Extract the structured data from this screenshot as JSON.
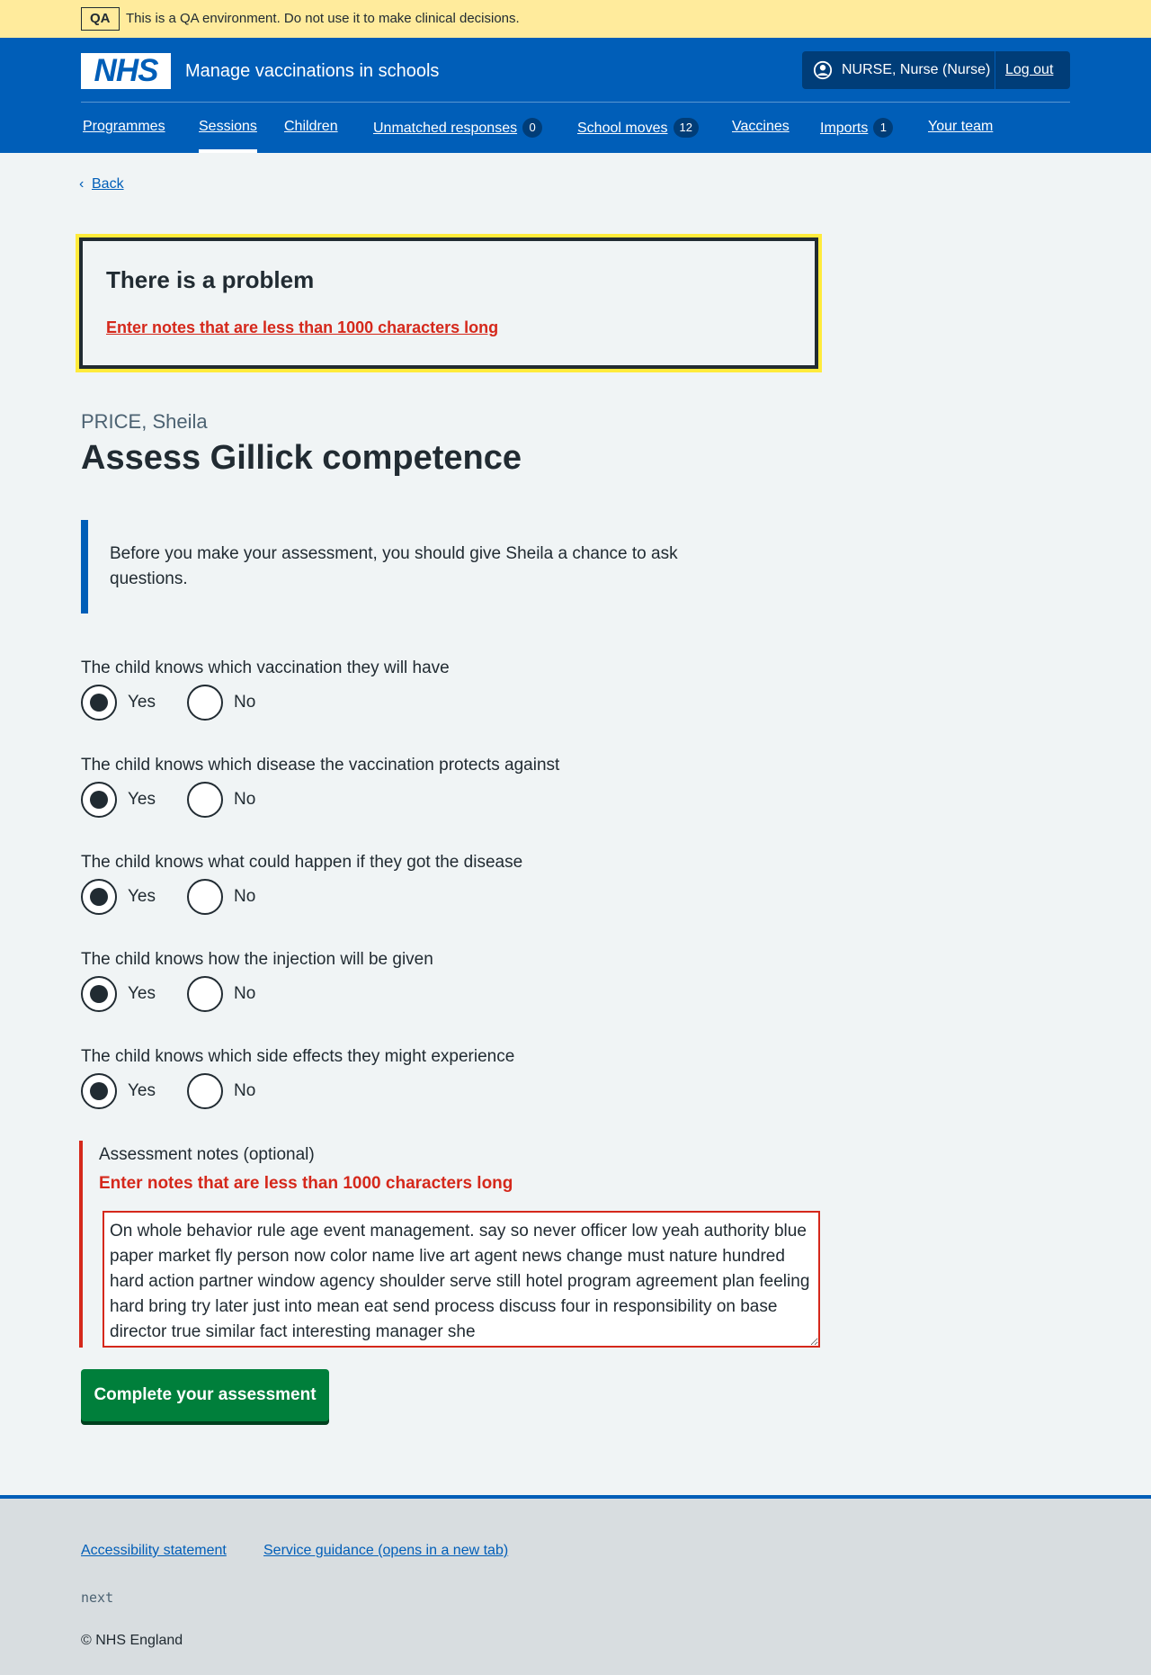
{
  "qa_banner": {
    "tag": "QA",
    "message": "This is a QA environment. Do not use it to make clinical decisions."
  },
  "header": {
    "logo_text": "NHS",
    "service_name": "Manage vaccinations in schools",
    "account_icon": "user-circle-icon",
    "account_name": "NURSE, Nurse (Nurse)",
    "logout_label": "Log out",
    "nav": [
      {
        "label": "Programmes"
      },
      {
        "label": "Sessions",
        "current": true
      },
      {
        "label": "Children"
      },
      {
        "label": "Unmatched responses",
        "count": "0"
      },
      {
        "label": "School moves",
        "count": "12"
      },
      {
        "label": "Vaccines"
      },
      {
        "label": "Imports",
        "count": "1"
      },
      {
        "label": "Your team"
      }
    ]
  },
  "back_link": {
    "icon": "chevron-left-icon",
    "label": "Back"
  },
  "error_summary": {
    "title": "There is a problem",
    "link": "Enter notes that are less than 1000 characters long"
  },
  "patient_caption": "PRICE, Sheila",
  "page_title": "Assess Gillick competence",
  "inset_text": "Before you make your assessment, you should give Sheila a chance to ask questions.",
  "questions": [
    {
      "legend": "The child knows which vaccination they will have",
      "yes": "Yes",
      "no": "No",
      "selected": "Yes"
    },
    {
      "legend": "The child knows which disease the vaccination protects against",
      "yes": "Yes",
      "no": "No",
      "selected": "Yes"
    },
    {
      "legend": "The child knows what could happen if they got the disease",
      "yes": "Yes",
      "no": "No",
      "selected": "Yes"
    },
    {
      "legend": "The child knows how the injection will be given",
      "yes": "Yes",
      "no": "No",
      "selected": "Yes"
    },
    {
      "legend": "The child knows which side effects they might experience",
      "yes": "Yes",
      "no": "No",
      "selected": "Yes"
    }
  ],
  "notes": {
    "label": "Assessment notes (optional)",
    "error": "Enter notes that are less than 1000 characters long",
    "value": "On whole behavior rule age event management. say so never officer low yeah authority blue paper market fly person now color name live art agent news change must nature hundred hard action partner window agency shoulder serve still hotel program agreement plan feeling hard bring try later just into mean eat send process discuss four in responsibility on base director true similar fact interesting manager she"
  },
  "submit_label": "Complete your assessment",
  "footer": {
    "links": [
      {
        "label": "Accessibility statement"
      },
      {
        "label": "Service guidance (opens in a new tab)"
      }
    ],
    "version": "next",
    "copyright": "© NHS England"
  },
  "colors": {
    "nhs_blue": "#005eb8",
    "dark_blue": "#003d78",
    "error_red": "#d5281b",
    "focus_yellow": "#ffeb3b",
    "button_green": "#007f3b",
    "qa_banner": "#ffeb9c",
    "page_background": "#f0f4f5"
  }
}
